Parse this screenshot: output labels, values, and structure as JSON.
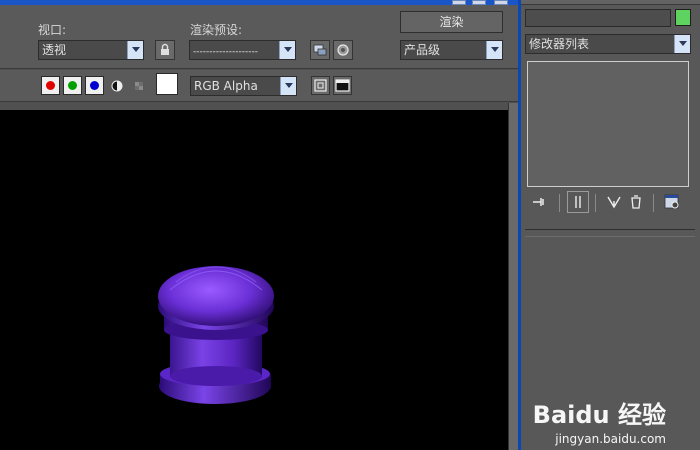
{
  "toolbar": {
    "viewport_label": "视口:",
    "viewport_value": "透视",
    "preset_label": "渲染预设:",
    "preset_value": "--------------------",
    "render_button": "渲染",
    "quality_value": "产品级"
  },
  "channels": {
    "red": "#e00000",
    "green": "#00a000",
    "blue": "#0000d0",
    "display_value": "RGB Alpha"
  },
  "panel": {
    "modifier_list": "修改器列表",
    "object_color": "#5fd35f"
  },
  "watermark": {
    "brand": "Baidu 经验",
    "url": "jingyan.baidu.com"
  },
  "colors": {
    "object": "#6a2fd6",
    "viewport_bg": "#000000",
    "accent_blue": "#0a46b4"
  }
}
